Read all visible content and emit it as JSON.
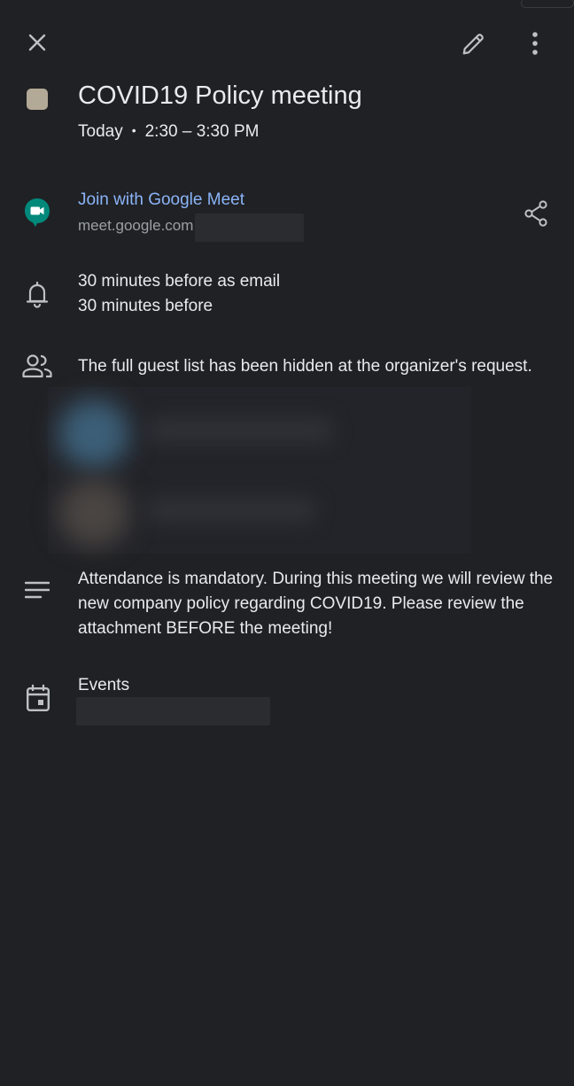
{
  "header": {
    "close_icon": "close-icon",
    "edit_icon": "pencil-icon",
    "more_icon": "more-vert-icon"
  },
  "event": {
    "title": "COVID19 Policy meeting",
    "date": "Today",
    "separator": "•",
    "time": "2:30 – 3:30 PM",
    "color": "#b2a996"
  },
  "meet": {
    "link_label": "Join with Google Meet",
    "url": "meet.google.com",
    "icon": "google-meet-icon",
    "share_icon": "share-icon"
  },
  "notifications": {
    "icon": "bell-icon",
    "items": [
      "30 minutes before as email",
      "30 minutes before"
    ]
  },
  "guests": {
    "icon": "people-icon",
    "note": "The full guest list has been hidden at the organizer's request."
  },
  "description": {
    "icon": "notes-icon",
    "text": "Attendance is mandatory. During this meeting we will review the new company policy regarding COVID19. Please review the attachment BEFORE the meeting!"
  },
  "calendar": {
    "icon": "calendar-event-icon",
    "name": "Events"
  },
  "colors": {
    "background": "#202124",
    "text": "#e8eaed",
    "link": "#8ab4f8",
    "secondary": "#9aa0a6",
    "meet_green": "#00897b"
  }
}
